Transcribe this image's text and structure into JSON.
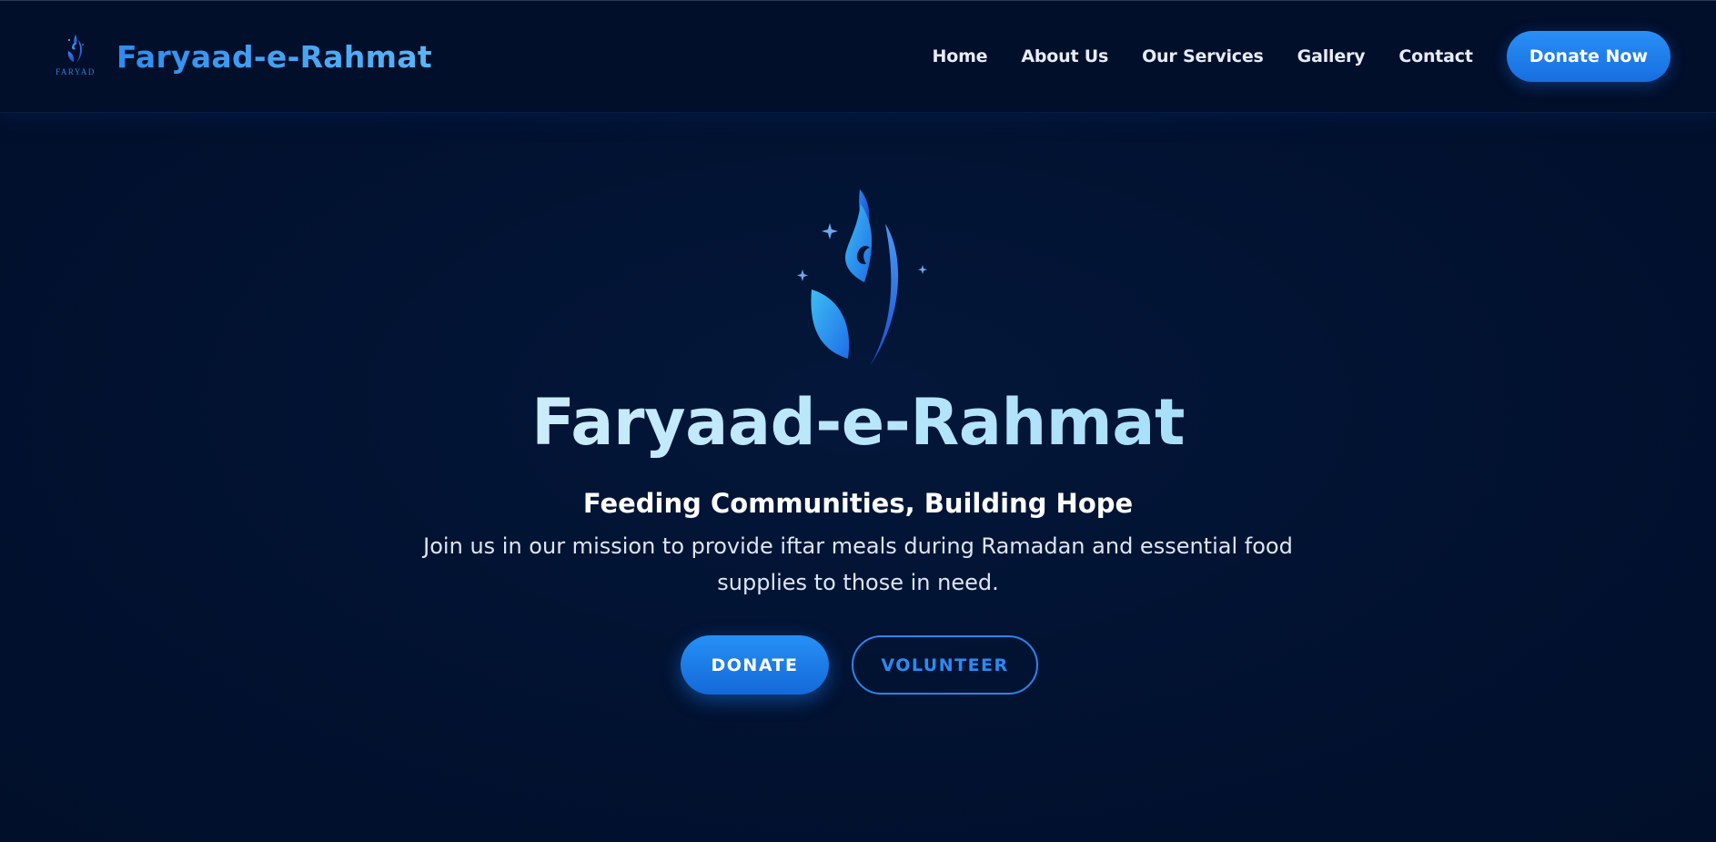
{
  "nav": {
    "logo_text": "FARYAD",
    "brand_name": "Faryaad-e-Rahmat",
    "links": [
      "Home",
      "About Us",
      "Our Services",
      "Gallery",
      "Contact"
    ],
    "cta_label": "Donate Now",
    "logo_icon": "flame-crescent-icon"
  },
  "hero": {
    "logo_icon": "flame-crescent-icon",
    "title": "Faryaad-e-Rahmat",
    "subtitle": "Feeding Communities, Building Hope",
    "description": "Join us in our mission to provide iftar meals during Ramadan and essential food supplies to those in need.",
    "donate_label": "DONATE",
    "volunteer_label": "VOLUNTEER"
  },
  "colors": {
    "background": "#01112f",
    "navbar": "#020f2b",
    "accent": "#1f7ff0",
    "title_gradient_start": "#e9f7ff",
    "title_gradient_end": "#8fd6f6"
  }
}
